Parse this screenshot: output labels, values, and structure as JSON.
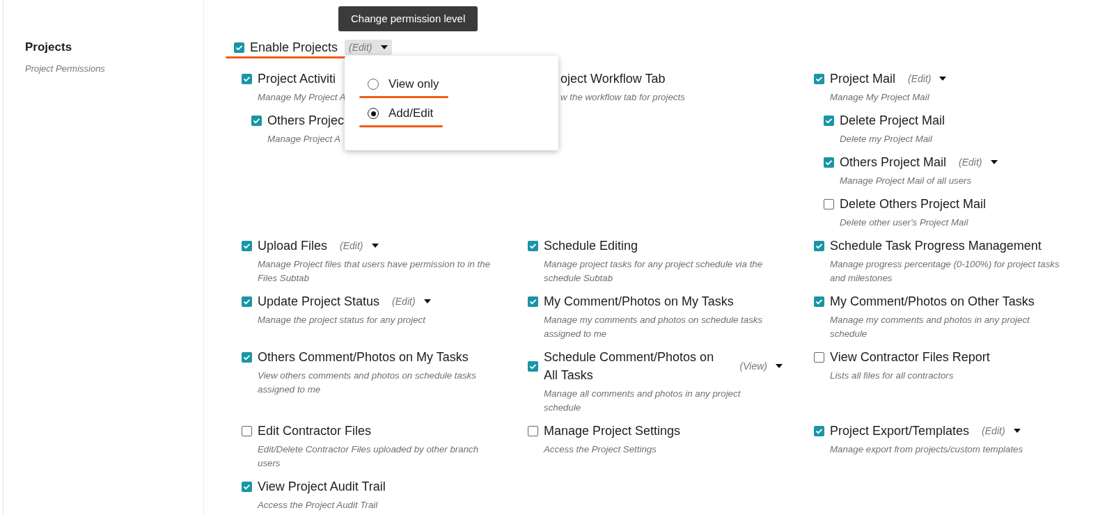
{
  "section": {
    "title": "Projects",
    "subtitle": "Project Permissions"
  },
  "tooltip": "Change permission level",
  "master": {
    "label": "Enable Projects",
    "checked": true,
    "permission": "(Edit)",
    "expanded": true,
    "underlined": true
  },
  "menu": [
    {
      "label": "View only",
      "selected": false,
      "underlined": true
    },
    {
      "label": "Add/Edit",
      "selected": true,
      "underlined": true
    }
  ],
  "groups": [
    {
      "kind": "checkbox",
      "label": "Project Activiti",
      "description": "Manage My Project A",
      "checked": true,
      "children": [
        {
          "label": "Others Projec",
          "description": "Manage Project A",
          "checked": true
        }
      ]
    },
    {
      "kind": "covered",
      "label": "oject Workflow Tab",
      "description": "w the workflow tab for projects"
    },
    {
      "kind": "checkbox",
      "label": "Project Mail",
      "permission": "(Edit)",
      "description": "Manage My Project Mail",
      "checked": true,
      "children": [
        {
          "label": "Delete Project Mail",
          "description": "Delete my Project Mail",
          "checked": true
        },
        {
          "label": "Others Project Mail",
          "permission": "(Edit)",
          "description": "Manage Project Mail of all users",
          "checked": true
        },
        {
          "label": "Delete Others Project Mail",
          "description": "Delete other user's Project Mail",
          "checked": false
        }
      ]
    }
  ],
  "permissions": [
    {
      "label": "Upload Files",
      "permission": "(Edit)",
      "description": "Manage Project files that users have permission to in the Files Subtab",
      "checked": true
    },
    {
      "label": "Schedule Editing",
      "description": "Manage project tasks for any project schedule via the schedule Subtab",
      "checked": true
    },
    {
      "label": "Schedule Task Progress Management",
      "description": "Manage progress percentage (0-100%) for project tasks and milestones",
      "checked": true
    },
    {
      "label": "Update Project Status",
      "permission": "(Edit)",
      "description": "Manage the project status for any project",
      "checked": true
    },
    {
      "label": "My Comment/Photos on My Tasks",
      "description": "Manage my comments and photos on schedule tasks assigned to me",
      "checked": true
    },
    {
      "label": "My Comment/Photos on Other Tasks",
      "description": "Manage my comments and photos in any project schedule",
      "checked": true
    },
    {
      "label": "Others Comment/Photos on My Tasks",
      "description": "View others comments and photos on schedule tasks assigned to me",
      "checked": true
    },
    {
      "label": "Schedule Comment/Photos on All Tasks",
      "permission": "(View)",
      "description": "Manage all comments and photos in any project schedule",
      "checked": true
    },
    {
      "label": "View Contractor Files Report",
      "description": "Lists all files for all contractors",
      "checked": false
    },
    {
      "label": "Edit Contractor Files",
      "description": "Edit/Delete Contractor Files uploaded by other branch users",
      "checked": false
    },
    {
      "label": "Manage Project Settings",
      "description": "Access the Project Settings",
      "checked": false
    },
    {
      "label": "Project Export/Templates",
      "permission": "(Edit)",
      "description": "Manage export from projects/custom templates",
      "checked": true
    },
    {
      "label": "View Project Audit Trail",
      "description": "Access the Project Audit Trail",
      "checked": true
    }
  ]
}
